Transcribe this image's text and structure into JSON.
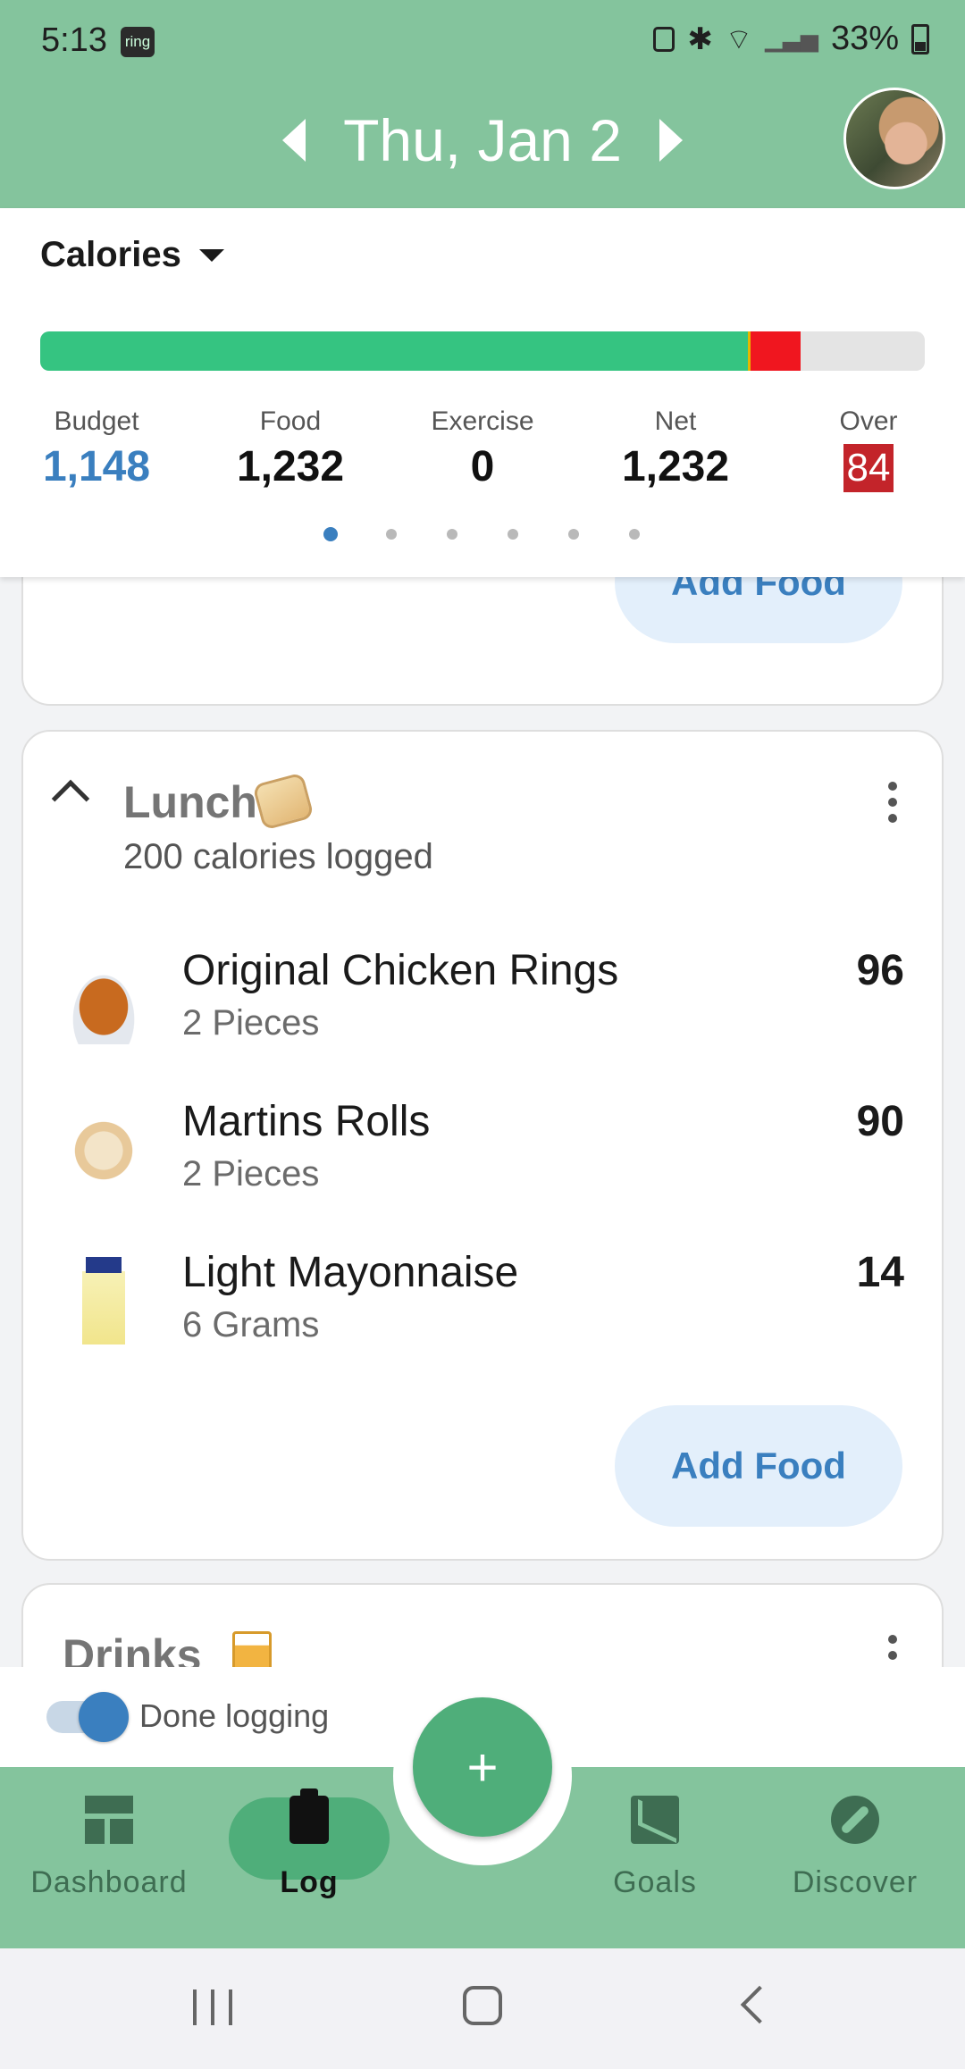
{
  "status": {
    "time": "5:13",
    "ring_badge": "ring",
    "battery": "33%"
  },
  "header": {
    "date": "Thu, Jan 2"
  },
  "summary": {
    "metric": "Calories",
    "progress": {
      "food_fraction": 0.8,
      "over_fraction": 0.06
    },
    "stats": {
      "budget": {
        "label": "Budget",
        "value": "1,148"
      },
      "food": {
        "label": "Food",
        "value": "1,232"
      },
      "exercise": {
        "label": "Exercise",
        "value": "0"
      },
      "net": {
        "label": "Net",
        "value": "1,232"
      },
      "over": {
        "label": "Over",
        "value": "84"
      }
    },
    "page_dots": {
      "count": 6,
      "active": 0
    }
  },
  "breakfast": {
    "add_food": "Add Food"
  },
  "lunch": {
    "title": "Lunch",
    "subtitle": "200 calories logged",
    "items": [
      {
        "name": "Original Chicken Rings",
        "serving": "2 Pieces",
        "calories": "96",
        "icon": "roast-chicken-icon"
      },
      {
        "name": "Martins Rolls",
        "serving": "2 Pieces",
        "calories": "90",
        "icon": "bread-roll-icon"
      },
      {
        "name": "Light Mayonnaise",
        "serving": "6 Grams",
        "calories": "14",
        "icon": "mayonnaise-jar-icon"
      }
    ],
    "add_food": "Add Food"
  },
  "drinks": {
    "title": "Drinks"
  },
  "done_logging": {
    "label": "Done logging",
    "enabled": true
  },
  "fab": {
    "label": "+"
  },
  "nav": {
    "items": [
      {
        "label": "Dashboard",
        "icon": "dashboard-icon"
      },
      {
        "label": "Log",
        "icon": "clipboard-icon",
        "active": true
      },
      {
        "label": "Goals",
        "icon": "trend-icon"
      },
      {
        "label": "Discover",
        "icon": "compass-icon"
      }
    ]
  },
  "colors": {
    "header": "#84c49d",
    "accent": "#3a7fbf",
    "food_bar": "#35c481",
    "over_bar": "#f0161f"
  }
}
